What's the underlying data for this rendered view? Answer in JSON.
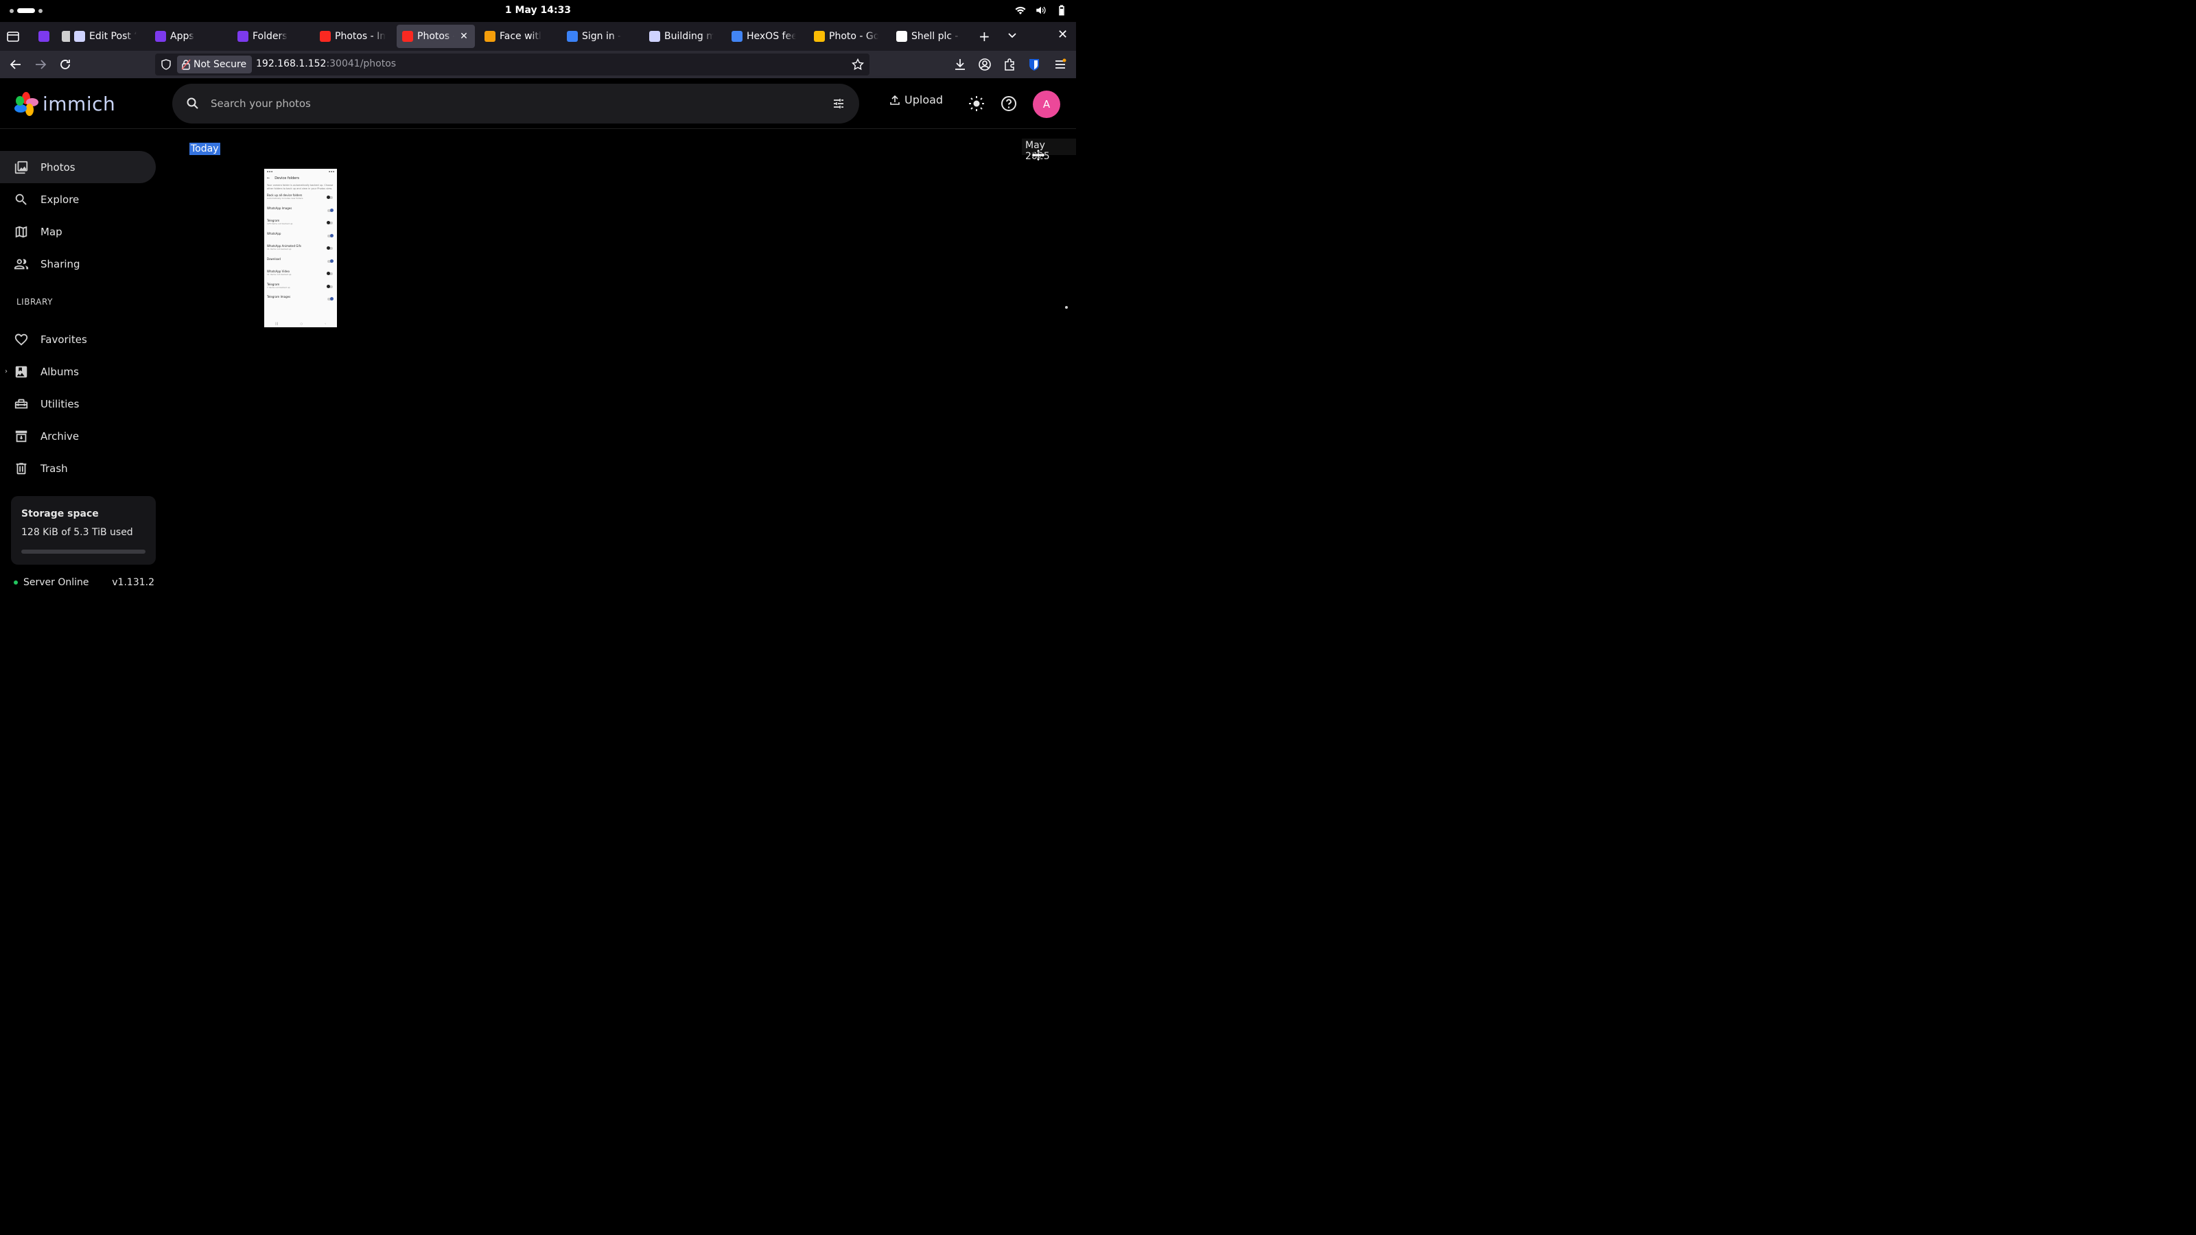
{
  "system": {
    "clock": "1 May  14:33"
  },
  "tabs": [
    {
      "title": "",
      "icon": "hexos-icon",
      "color": "#7c3aed"
    },
    {
      "title": "",
      "icon": "pin-icon",
      "color": "#cfcfcf"
    },
    {
      "title": "Edit Post “H",
      "icon": "wordpress-icon",
      "color": "#cfd3ff"
    },
    {
      "title": "Apps",
      "icon": "hexos-icon",
      "color": "#7c3aed"
    },
    {
      "title": "Folders",
      "icon": "hexos-icon",
      "color": "#7c3aed"
    },
    {
      "title": "Photos - Imr",
      "icon": "immich-icon",
      "color": "#fa2921"
    },
    {
      "title": "Photos - I",
      "icon": "immich-icon",
      "color": "#fa2921",
      "active": true
    },
    {
      "title": "Face witl",
      "icon": "emoji-icon",
      "color": "#f59e0b"
    },
    {
      "title": "Sign in -",
      "icon": "signin-icon",
      "color": "#3b82f6"
    },
    {
      "title": "Building my",
      "icon": "wordpress-icon",
      "color": "#cfd3ff"
    },
    {
      "title": "HexOS feedl",
      "icon": "docs-icon",
      "color": "#4285f4"
    },
    {
      "title": "Photo - Goo",
      "icon": "google-photos-icon",
      "color": "#fbbc04"
    },
    {
      "title": "Shell plc - W",
      "icon": "wikipedia-icon",
      "color": "#ffffff"
    }
  ],
  "navbar": {
    "not_secure": "Not Secure",
    "url_host": "192.168.1.152",
    "url_rest": ":30041/photos"
  },
  "header": {
    "logo_text": "immich",
    "search_placeholder": "Search your photos",
    "upload_label": "Upload",
    "avatar_initial": "A"
  },
  "sidebar": {
    "items": [
      {
        "label": "Photos",
        "active": true
      },
      {
        "label": "Explore"
      },
      {
        "label": "Map"
      },
      {
        "label": "Sharing"
      }
    ],
    "library_label": "LIBRARY",
    "library_items": [
      {
        "label": "Favorites"
      },
      {
        "label": "Albums"
      },
      {
        "label": "Utilities"
      },
      {
        "label": "Archive"
      },
      {
        "label": "Trash"
      }
    ],
    "storage": {
      "title": "Storage space",
      "used": "128 KiB of 5.3 TiB used",
      "fraction": 0.0
    },
    "server": {
      "status": "Server Online",
      "version": "v1.131.2"
    }
  },
  "timeline": {
    "group_label": "Today",
    "scrubber_label": "May 2025",
    "thumbnail": {
      "title": "Device folders",
      "description": "Your camera folder is automatically backed up. Choose other folders to back up and view in your Photos view.",
      "rows": [
        {
          "label": "Back up all device folders",
          "sub": "Automatically includes new folders",
          "on": false
        },
        {
          "label": "WhatsApp Images",
          "sub": "",
          "on": true
        },
        {
          "label": "Telegram",
          "sub": "125 items not backed up",
          "on": false
        },
        {
          "label": "WhatsApp",
          "sub": "",
          "on": true
        },
        {
          "label": "WhatsApp Animated Gifs",
          "sub": "11 items not backed up",
          "on": false
        },
        {
          "label": "Download",
          "sub": "",
          "on": true
        },
        {
          "label": "WhatsApp Video",
          "sub": "11 items not backed up",
          "on": false
        },
        {
          "label": "Telegram",
          "sub": "7 items not backed up",
          "on": false
        },
        {
          "label": "Telegram Images",
          "sub": "",
          "on": true
        }
      ]
    }
  }
}
